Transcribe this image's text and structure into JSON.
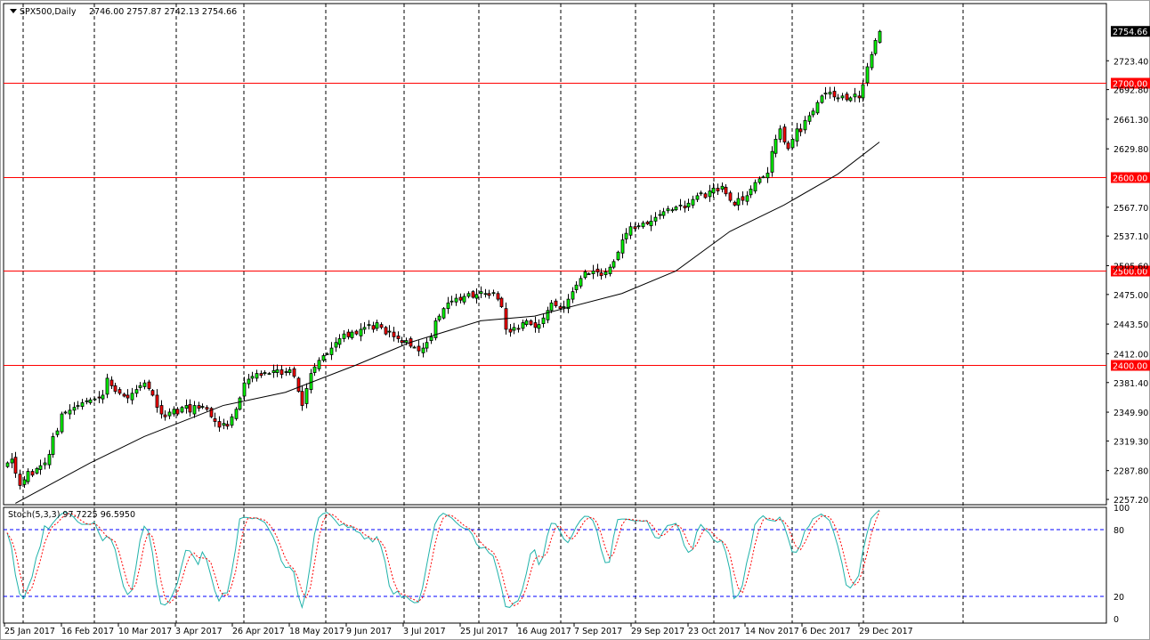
{
  "header": {
    "symbol": "SPX500,Daily",
    "ohlc": "2746.00 2757.87 2742.13 2754.66"
  },
  "stoch_header": {
    "label": "Stoch(5,3,3) 97.7225 96.5950"
  },
  "colors": {
    "bull": "#00ff00",
    "bear": "#ff0000",
    "level": "#ff0000",
    "stoch_main": "#20b2aa",
    "stoch_signal": "#ff0000",
    "stoch_levels": "#0000ff",
    "current_badge": "#000000"
  },
  "chart_data": {
    "type": "candlestick",
    "title": "SPX500,Daily",
    "ylim": [
      2250,
      2765
    ],
    "price_ticks": [
      "2723.40",
      "2692.80",
      "2661.30",
      "2629.80",
      "2567.70",
      "2537.10",
      "2505.60",
      "2475.00",
      "2443.50",
      "2412.00",
      "2381.40",
      "2349.90",
      "2319.30",
      "2287.80",
      "2257.20"
    ],
    "levels": [
      "2700.00",
      "2600.00",
      "2500.00",
      "2400.00"
    ],
    "current_price": "2754.66",
    "date_labels": [
      "25 Jan 2017",
      "16 Feb 2017",
      "10 Mar 2017",
      "3 Apr 2017",
      "26 Apr 2017",
      "18 May 2017",
      "9 Jun 2017",
      "3 Jul 2017",
      "25 Jul 2017",
      "16 Aug 2017",
      "7 Sep 2017",
      "29 Sep 2017",
      "23 Oct 2017",
      "14 Nov 2017",
      "6 Dec 2017",
      "29 Dec 2017"
    ],
    "close": [
      2296,
      2300,
      2285,
      2272,
      2278,
      2287,
      2283,
      2290,
      2293,
      2296,
      2305,
      2324,
      2330,
      2348,
      2350,
      2352,
      2355,
      2357,
      2360,
      2362,
      2363,
      2364,
      2365,
      2368,
      2386,
      2378,
      2372,
      2370,
      2367,
      2365,
      2370,
      2374,
      2378,
      2381,
      2375,
      2368,
      2355,
      2348,
      2345,
      2350,
      2353,
      2348,
      2355,
      2357,
      2350,
      2357,
      2354,
      2356,
      2353,
      2345,
      2340,
      2334,
      2338,
      2335,
      2345,
      2353,
      2365,
      2381,
      2385,
      2388,
      2391,
      2389,
      2392,
      2391,
      2394,
      2395,
      2390,
      2393,
      2395,
      2388,
      2372,
      2357,
      2375,
      2391,
      2398,
      2405,
      2410,
      2412,
      2418,
      2424,
      2428,
      2433,
      2430,
      2435,
      2433,
      2438,
      2440,
      2443,
      2438,
      2445,
      2440,
      2433,
      2436,
      2430,
      2428,
      2424,
      2426,
      2420,
      2419,
      2415,
      2418,
      2424,
      2430,
      2447,
      2452,
      2460,
      2466,
      2468,
      2471,
      2469,
      2473,
      2476,
      2472,
      2475,
      2478,
      2476,
      2474,
      2477,
      2470,
      2462,
      2438,
      2435,
      2440,
      2438,
      2445,
      2447,
      2443,
      2440,
      2443,
      2450,
      2458,
      2466,
      2463,
      2460,
      2462,
      2470,
      2478,
      2485,
      2492,
      2499,
      2497,
      2500,
      2499,
      2495,
      2499,
      2504,
      2510,
      2520,
      2533,
      2540,
      2547,
      2545,
      2548,
      2551,
      2550,
      2553,
      2557,
      2560,
      2563,
      2566,
      2565,
      2568,
      2570,
      2567,
      2572,
      2576,
      2580,
      2583,
      2578,
      2585,
      2588,
      2585,
      2590,
      2582,
      2575,
      2570,
      2577,
      2575,
      2580,
      2587,
      2594,
      2598,
      2600,
      2604,
      2627,
      2640,
      2651,
      2637,
      2630,
      2640,
      2651,
      2648,
      2660,
      2665,
      2670,
      2679,
      2686,
      2689,
      2690,
      2685,
      2684,
      2686,
      2682,
      2684,
      2688,
      2684,
      2698,
      2717,
      2730,
      2745,
      2754.66
    ],
    "moving_average": [
      [
        2,
        2253
      ],
      [
        20,
        2296
      ],
      [
        33,
        2324
      ],
      [
        52,
        2357
      ],
      [
        67,
        2371
      ],
      [
        84,
        2400
      ],
      [
        97,
        2424
      ],
      [
        114,
        2447
      ],
      [
        127,
        2452
      ],
      [
        148,
        2476
      ],
      [
        161,
        2500
      ],
      [
        174,
        2542
      ],
      [
        187,
        2570
      ],
      [
        200,
        2603
      ],
      [
        210,
        2637
      ]
    ],
    "stochastic": {
      "k": 5,
      "d": 3,
      "slowing": 3,
      "levels": [
        80,
        20
      ],
      "ticks": [
        "100",
        "80",
        "20",
        "0"
      ],
      "last_main": 97.7225,
      "last_signal": 96.595
    }
  }
}
